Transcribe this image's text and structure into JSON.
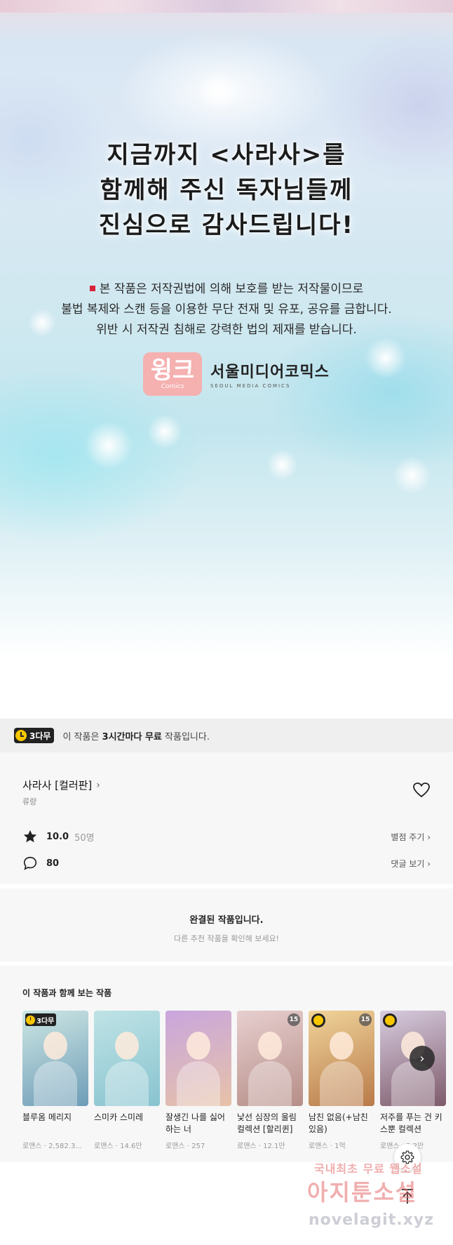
{
  "hero": {
    "thanks_lines": [
      "지금까지 <사라사>를",
      "함께해 주신 독자님들께",
      "진심으로 감사드립니다!"
    ],
    "notice_lines": [
      "본 작품은 저작권법에 의해 보호를 받는 저작물이므로",
      "불법 복제와 스캔 등을 이용한 무단 전재 및 유포, 공유를 금합니다.",
      "위반 시 저작권 침해로 강력한 법의 제재를 받습니다."
    ],
    "logo_wink": "윙크",
    "logo_wink_sub": "Comics",
    "logo_seoul": "서울미디어코믹스",
    "logo_seoul_en": "SEOUL MEDIA COMICS"
  },
  "free_banner": {
    "badge": "3다무",
    "text_before": "이 작품은 ",
    "text_bold": "3시간마다 무료",
    "text_after": " 작품입니다."
  },
  "series": {
    "title": "사라사 [컬러판]",
    "author": "류량",
    "rating": "10.0",
    "rating_count": "50명",
    "rate_action": "별점 주기 ›",
    "comments": "80",
    "comment_action": "댓글 보기 ›"
  },
  "complete": {
    "heading": "완결된 작품입니다.",
    "sub": "다른 추천 작품을 확인해 보세요!"
  },
  "recs": {
    "title": "이 작품과 함께 보는 작품",
    "items": [
      {
        "name": "블루옴 메리지",
        "meta": "로맨스 · 2,582.3...",
        "badge": "3다무",
        "age": "",
        "colors": [
          "#cde7e4",
          "#6e9cb7"
        ]
      },
      {
        "name": "스미카 스미레",
        "meta": "로맨스 · 14.6만",
        "badge": "",
        "age": "",
        "colors": [
          "#bfe3e6",
          "#88c3cf"
        ]
      },
      {
        "name": "잘생긴 나를 싫어하는 너",
        "meta": "로맨스 · 257",
        "badge": "",
        "age": "",
        "colors": [
          "#c9a6de",
          "#e6c2a8"
        ]
      },
      {
        "name": "낯선 심장의 울림 컬렉션 [할리퀸]",
        "meta": "로맨스 · 12.1만",
        "badge": "",
        "age": "15",
        "colors": [
          "#e7cfcf",
          "#b68e88"
        ]
      },
      {
        "name": "남친 없음(+남친 있음)",
        "meta": "로맨스 · 1억",
        "badge": "clock",
        "age": "15",
        "colors": [
          "#f0d49a",
          "#b97a4a"
        ]
      },
      {
        "name": "저주를 푸는 건 키스뿐 컬렉션",
        "meta": "로맨스 · 3.2만",
        "badge": "clock",
        "age": "",
        "colors": [
          "#d8cde0",
          "#7d5a6a"
        ]
      }
    ]
  },
  "watermark": {
    "line1": "국내최초 무료 웹소설",
    "line2": "아지툰소설",
    "line3": "novelagit.xyz"
  },
  "colors": {
    "free_accent": "#f7c600",
    "notice_red": "#d8243a",
    "wink_pink": "#f5b0b0"
  }
}
